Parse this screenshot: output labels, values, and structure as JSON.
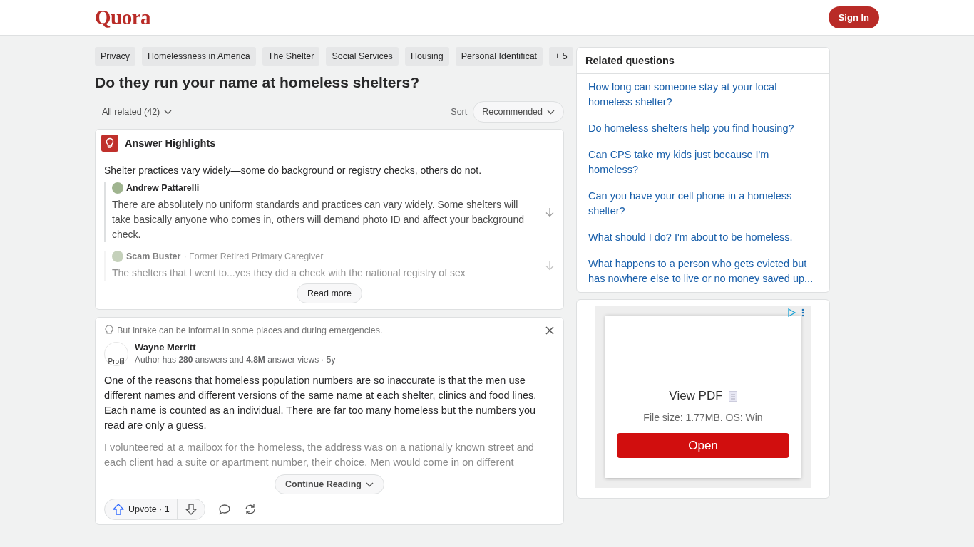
{
  "header": {
    "logo": "Quora",
    "sign_in": "Sign In"
  },
  "topics": [
    {
      "label": "Privacy"
    },
    {
      "label": "Homelessness in America"
    },
    {
      "label": "The Shelter"
    },
    {
      "label": "Social Services"
    },
    {
      "label": "Housing"
    },
    {
      "label": "Personal Identificat"
    }
  ],
  "topics_more": "+ 5",
  "question": "Do they run your name at homeless shelters?",
  "filter": {
    "label": "All related (42)",
    "sort_label": "Sort",
    "sort_value": "Recommended"
  },
  "highlights": {
    "title": "Answer Highlights",
    "summary": "Shelter practices vary widely—some do background or registry checks, others do not.",
    "quotes": [
      {
        "author": "Andrew Pattarelli",
        "text": "There are absolutely no uniform standards and practices can vary widely. Some shelters will take basically anyone who comes in, others will demand photo ID and affect your background check.",
        "faded": false
      },
      {
        "author": "Scam Buster",
        "credential": "· Former Retired Primary Caregiver",
        "text": "The shelters that I went to...yes they did a check with the national registry of sex",
        "faded": true
      }
    ],
    "read_more": "Read more"
  },
  "answer": {
    "note": "But intake can be informal in some places and during emergencies.",
    "avatar_alt": "Profil",
    "author": "Wayne Merritt",
    "stats": "Author has **280** answers and **4.8M** answer views · 5y",
    "paragraphs": [
      {
        "text": "One of the reasons that homeless population numbers are so inaccurate is that the men use different names and different versions of the same name at each shelter, clinics and food lines. Each name is counted as an individual. There are far too many homeless but the numbers you read are only a guess.",
        "faded": false
      },
      {
        "text": "I volunteered at a mailbox for the homeless, the address was on a nationally known street and each client had a suite or apartment number, their choice. Men would come in on different",
        "faded": true
      }
    ],
    "continue": "Continue Reading",
    "upvote": "Upvote · 1"
  },
  "related": {
    "title": "Related questions",
    "items": [
      "How long can someone stay at your local homeless shelter?",
      "Do homeless shelters help you find housing?",
      "Can CPS take my kids just because I'm homeless?",
      "Can you have your cell phone in a homeless shelter?",
      "What should I do? I'm about to be homeless.",
      "What happens to a person who gets evicted but has nowhere else to live or no money saved up..."
    ]
  },
  "ad": {
    "title": "View PDF",
    "info": "File size: 1.77MB. OS: Win",
    "button": "Open"
  }
}
